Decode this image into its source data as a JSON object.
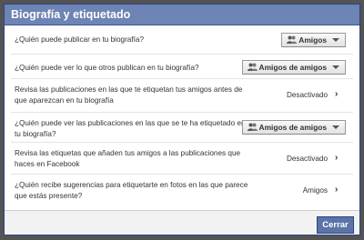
{
  "dialog": {
    "title": "Biografía y etiquetado",
    "close_label": "Cerrar"
  },
  "settings": [
    {
      "question": "¿Quién puede publicar en tu biografía?",
      "value": "Amigos",
      "control": "dropdown"
    },
    {
      "question": "¿Quién puede ver lo que otros publican en tu biografía?",
      "value": "Amigos de amigos",
      "control": "dropdown"
    },
    {
      "question_line1": "Revisa las publicaciones en las que te etiquetan tus amigos antes de",
      "question_line2": "que aparezcan en tu biografía",
      "value": "Desactivado",
      "control": "link"
    },
    {
      "question_line1": "¿Quién puede ver las publicaciones en las que se te ha etiquetado en",
      "question_line2": "tu biografía?",
      "value": "Amigos de amigos",
      "control": "dropdown"
    },
    {
      "question_line1": "Revisa las etiquetas que añaden tus amigos a las publicaciones que",
      "question_line2": "haces en Facebook",
      "value": "Desactivado",
      "control": "link"
    },
    {
      "question_line1": "¿Quién recibe sugerencias para etiquetarte en fotos en las que parece",
      "question_line2": "que estás presente?",
      "value": "Amigos",
      "control": "link"
    }
  ],
  "icons": {
    "audience": "people-icon",
    "dropdown": "triangle-down-icon",
    "chevron": "chevron-right-icon"
  },
  "colors": {
    "titlebar": "#6d84b4",
    "button": "#5b74a8"
  }
}
